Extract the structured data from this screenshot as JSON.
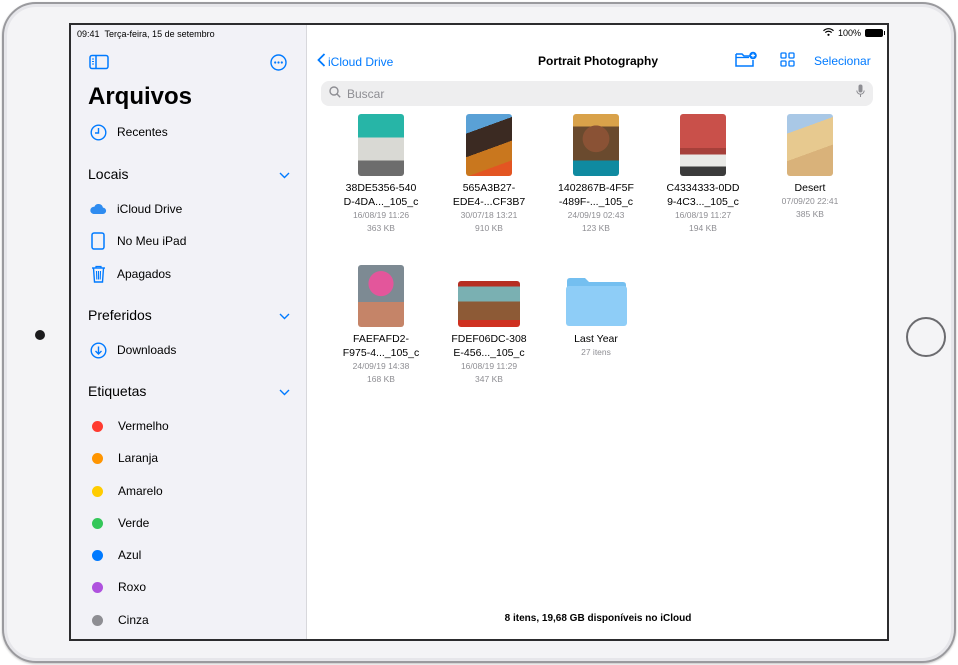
{
  "status_bar": {
    "time": "09:41",
    "date": "Terça-feira, 15 de setembro",
    "battery": "100%"
  },
  "sidebar": {
    "title": "Arquivos",
    "recents_label": "Recentes",
    "sections": {
      "locations": {
        "title": "Locais",
        "items": [
          {
            "label": "iCloud Drive",
            "icon": "icloud-icon"
          },
          {
            "label": "No Meu iPad",
            "icon": "ipad-icon"
          },
          {
            "label": "Apagados",
            "icon": "trash-icon"
          }
        ]
      },
      "favorites": {
        "title": "Preferidos",
        "items": [
          {
            "label": "Downloads",
            "icon": "download-icon"
          }
        ]
      },
      "tags": {
        "title": "Etiquetas",
        "items": [
          {
            "label": "Vermelho",
            "color": "#ff3b30"
          },
          {
            "label": "Laranja",
            "color": "#ff9500"
          },
          {
            "label": "Amarelo",
            "color": "#ffcc00"
          },
          {
            "label": "Verde",
            "color": "#34c759"
          },
          {
            "label": "Azul",
            "color": "#007aff"
          },
          {
            "label": "Roxo",
            "color": "#af52de"
          },
          {
            "label": "Cinza",
            "color": "#8e8e93"
          }
        ]
      }
    }
  },
  "main": {
    "back_label": "iCloud Drive",
    "title": "Portrait Photography",
    "select_label": "Selecionar",
    "search_placeholder": "Buscar",
    "items": [
      {
        "name_line1": "38DE5356-540",
        "name_line2": "D-4DA..._105_c",
        "date": "16/08/19 11:26",
        "size": "363 KB"
      },
      {
        "name_line1": "565A3B27-",
        "name_line2": "EDE4-...CF3B7",
        "date": "30/07/18 13:21",
        "size": "910 KB"
      },
      {
        "name_line1": "1402867B-4F5F",
        "name_line2": "-489F-..._105_c",
        "date": "24/09/19 02:43",
        "size": "123 KB"
      },
      {
        "name_line1": "C4334333-0DD",
        "name_line2": "9-4C3..._105_c",
        "date": "16/08/19 11:27",
        "size": "194 KB"
      },
      {
        "name_line1": "Desert",
        "name_line2": "",
        "date": "07/09/20 22:41",
        "size": "385 KB"
      },
      {
        "name_line1": "FAEFAFD2-",
        "name_line2": "F975-4..._105_c",
        "date": "24/09/19 14:38",
        "size": "168 KB"
      },
      {
        "name_line1": "FDEF06DC-308",
        "name_line2": "E-456..._105_c",
        "date": "16/08/19 11:29",
        "size": "347 KB"
      }
    ],
    "folder": {
      "name": "Last Year",
      "count": "27 itens"
    },
    "footer": "8 itens, 19,68 GB disponíveis no iCloud"
  },
  "colors": {
    "accent": "#007aff",
    "folder": "#8ecdf7"
  }
}
